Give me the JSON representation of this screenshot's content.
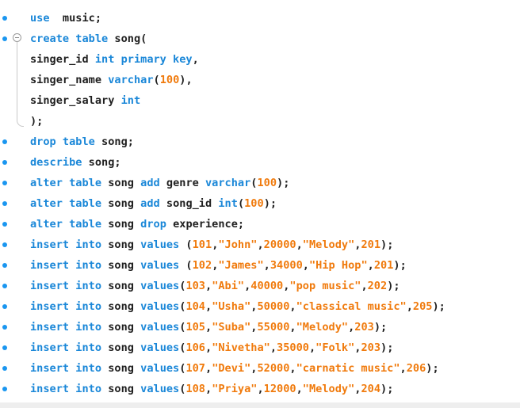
{
  "editor": {
    "lines": [
      {
        "bullet": true,
        "fold": false,
        "tokens": [
          [
            "kw",
            "use"
          ],
          [
            "pl",
            "  music;"
          ]
        ]
      },
      {
        "bullet": true,
        "fold": true,
        "tokens": [
          [
            "kw",
            "create table"
          ],
          [
            "pl",
            " song("
          ]
        ]
      },
      {
        "bullet": false,
        "fold": false,
        "tokens": [
          [
            "pl",
            "singer_id "
          ],
          [
            "kw",
            "int primary key"
          ],
          [
            "pl",
            ","
          ]
        ]
      },
      {
        "bullet": false,
        "fold": false,
        "tokens": [
          [
            "pl",
            "singer_name "
          ],
          [
            "kw",
            "varchar"
          ],
          [
            "pl",
            "("
          ],
          [
            "nm",
            "100"
          ],
          [
            "pl",
            "),"
          ]
        ]
      },
      {
        "bullet": false,
        "fold": false,
        "tokens": [
          [
            "pl",
            "singer_salary "
          ],
          [
            "kw",
            "int"
          ]
        ]
      },
      {
        "bullet": false,
        "fold": false,
        "tokens": [
          [
            "pl",
            ");"
          ]
        ]
      },
      {
        "bullet": true,
        "fold": false,
        "tokens": [
          [
            "kw",
            "drop table"
          ],
          [
            "pl",
            " song;"
          ]
        ]
      },
      {
        "bullet": true,
        "fold": false,
        "tokens": [
          [
            "kw",
            "describe"
          ],
          [
            "pl",
            " song;"
          ]
        ]
      },
      {
        "bullet": true,
        "fold": false,
        "tokens": [
          [
            "kw",
            "alter table"
          ],
          [
            "pl",
            " song "
          ],
          [
            "kw",
            "add"
          ],
          [
            "pl",
            " genre "
          ],
          [
            "kw",
            "varchar"
          ],
          [
            "pl",
            "("
          ],
          [
            "nm",
            "100"
          ],
          [
            "pl",
            ");"
          ]
        ]
      },
      {
        "bullet": true,
        "fold": false,
        "tokens": [
          [
            "kw",
            "alter table"
          ],
          [
            "pl",
            " song "
          ],
          [
            "kw",
            "add"
          ],
          [
            "pl",
            " song_id "
          ],
          [
            "kw",
            "int"
          ],
          [
            "pl",
            "("
          ],
          [
            "nm",
            "100"
          ],
          [
            "pl",
            ");"
          ]
        ]
      },
      {
        "bullet": true,
        "fold": false,
        "tokens": [
          [
            "kw",
            "alter table"
          ],
          [
            "pl",
            " song "
          ],
          [
            "kw",
            "drop"
          ],
          [
            "pl",
            " experience;"
          ]
        ]
      },
      {
        "bullet": true,
        "fold": false,
        "tokens": [
          [
            "kw",
            "insert into"
          ],
          [
            "pl",
            " song "
          ],
          [
            "kw",
            "values"
          ],
          [
            "pl",
            " ("
          ],
          [
            "nm",
            "101"
          ],
          [
            "pl",
            ","
          ],
          [
            "st",
            "\"John\""
          ],
          [
            "pl",
            ","
          ],
          [
            "nm",
            "20000"
          ],
          [
            "pl",
            ","
          ],
          [
            "st",
            "\"Melody\""
          ],
          [
            "pl",
            ","
          ],
          [
            "nm",
            "201"
          ],
          [
            "pl",
            ");"
          ]
        ]
      },
      {
        "bullet": true,
        "fold": false,
        "tokens": [
          [
            "kw",
            "insert into"
          ],
          [
            "pl",
            " song "
          ],
          [
            "kw",
            "values"
          ],
          [
            "pl",
            " ("
          ],
          [
            "nm",
            "102"
          ],
          [
            "pl",
            ","
          ],
          [
            "st",
            "\"James\""
          ],
          [
            "pl",
            ","
          ],
          [
            "nm",
            "34000"
          ],
          [
            "pl",
            ","
          ],
          [
            "st",
            "\"Hip Hop\""
          ],
          [
            "pl",
            ","
          ],
          [
            "nm",
            "201"
          ],
          [
            "pl",
            ");"
          ]
        ]
      },
      {
        "bullet": true,
        "fold": false,
        "tokens": [
          [
            "kw",
            "insert into"
          ],
          [
            "pl",
            " song "
          ],
          [
            "kw",
            "values"
          ],
          [
            "pl",
            "("
          ],
          [
            "nm",
            "103"
          ],
          [
            "pl",
            ","
          ],
          [
            "st",
            "\"Abi\""
          ],
          [
            "pl",
            ","
          ],
          [
            "nm",
            "40000"
          ],
          [
            "pl",
            ","
          ],
          [
            "st",
            "\"pop music\""
          ],
          [
            "pl",
            ","
          ],
          [
            "nm",
            "202"
          ],
          [
            "pl",
            ");"
          ]
        ]
      },
      {
        "bullet": true,
        "fold": false,
        "tokens": [
          [
            "kw",
            "insert into"
          ],
          [
            "pl",
            " song "
          ],
          [
            "kw",
            "values"
          ],
          [
            "pl",
            "("
          ],
          [
            "nm",
            "104"
          ],
          [
            "pl",
            ","
          ],
          [
            "st",
            "\"Usha\""
          ],
          [
            "pl",
            ","
          ],
          [
            "nm",
            "50000"
          ],
          [
            "pl",
            ","
          ],
          [
            "st",
            "\"classical music\""
          ],
          [
            "pl",
            ","
          ],
          [
            "nm",
            "205"
          ],
          [
            "pl",
            ");"
          ]
        ]
      },
      {
        "bullet": true,
        "fold": false,
        "tokens": [
          [
            "kw",
            "insert into"
          ],
          [
            "pl",
            " song "
          ],
          [
            "kw",
            "values"
          ],
          [
            "pl",
            "("
          ],
          [
            "nm",
            "105"
          ],
          [
            "pl",
            ","
          ],
          [
            "st",
            "\"Suba\""
          ],
          [
            "pl",
            ","
          ],
          [
            "nm",
            "55000"
          ],
          [
            "pl",
            ","
          ],
          [
            "st",
            "\"Melody\""
          ],
          [
            "pl",
            ","
          ],
          [
            "nm",
            "203"
          ],
          [
            "pl",
            ");"
          ]
        ]
      },
      {
        "bullet": true,
        "fold": false,
        "tokens": [
          [
            "kw",
            "insert into"
          ],
          [
            "pl",
            " song "
          ],
          [
            "kw",
            "values"
          ],
          [
            "pl",
            "("
          ],
          [
            "nm",
            "106"
          ],
          [
            "pl",
            ","
          ],
          [
            "st",
            "\"Nivetha\""
          ],
          [
            "pl",
            ","
          ],
          [
            "nm",
            "35000"
          ],
          [
            "pl",
            ","
          ],
          [
            "st",
            "\"Folk\""
          ],
          [
            "pl",
            ","
          ],
          [
            "nm",
            "203"
          ],
          [
            "pl",
            ");"
          ]
        ]
      },
      {
        "bullet": true,
        "fold": false,
        "tokens": [
          [
            "kw",
            "insert into"
          ],
          [
            "pl",
            " song "
          ],
          [
            "kw",
            "values"
          ],
          [
            "pl",
            "("
          ],
          [
            "nm",
            "107"
          ],
          [
            "pl",
            ","
          ],
          [
            "st",
            "\"Devi\""
          ],
          [
            "pl",
            ","
          ],
          [
            "nm",
            "52000"
          ],
          [
            "pl",
            ","
          ],
          [
            "st",
            "\"carnatic music\""
          ],
          [
            "pl",
            ","
          ],
          [
            "nm",
            "206"
          ],
          [
            "pl",
            ");"
          ]
        ]
      },
      {
        "bullet": true,
        "fold": false,
        "tokens": [
          [
            "kw",
            "insert into"
          ],
          [
            "pl",
            " song "
          ],
          [
            "kw",
            "values"
          ],
          [
            "pl",
            "("
          ],
          [
            "nm",
            "108"
          ],
          [
            "pl",
            ","
          ],
          [
            "st",
            "\"Priya\""
          ],
          [
            "pl",
            ","
          ],
          [
            "nm",
            "12000"
          ],
          [
            "pl",
            ","
          ],
          [
            "st",
            "\"Melody\""
          ],
          [
            "pl",
            ","
          ],
          [
            "nm",
            "204"
          ],
          [
            "pl",
            ");"
          ]
        ]
      }
    ]
  },
  "colors": {
    "keyword": "#1a87d8",
    "literal": "#f07a0c",
    "plain": "#1f1f1f",
    "bullet": "#1a96f0"
  }
}
